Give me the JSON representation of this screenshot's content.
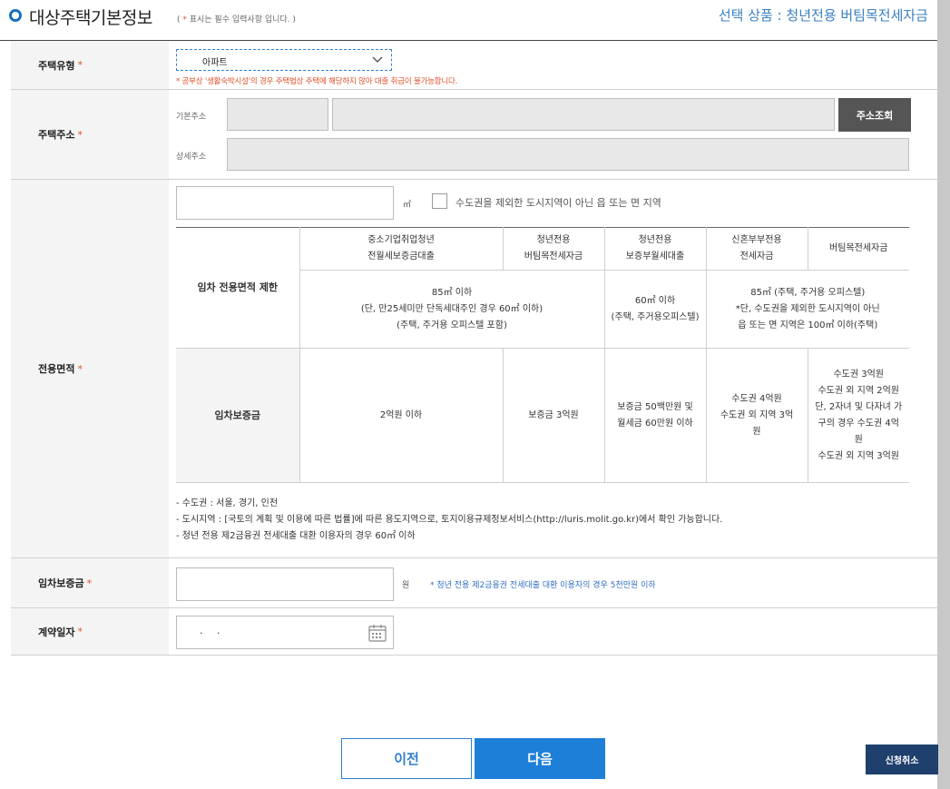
{
  "header": {
    "title": "대상주택기본정보",
    "required_note_star": "*",
    "required_note": " 표시는 필수 입력사항 입니다.",
    "product_label": "선택 상품 : 청년전용 버팀목전세자금"
  },
  "housing_type": {
    "label": "주택유형",
    "required_mark": "*",
    "selected": "아파트",
    "warning": "* 공부상 '생활숙박시설'의 경우 주택법상 주택에 해당하지 않아 대출 취급이 불가능합니다."
  },
  "address": {
    "label": "주택주소",
    "required_mark": "*",
    "basic_label": "기본주소",
    "detail_label": "상세주소",
    "search_button": "주소조회"
  },
  "area": {
    "label": "전용면적",
    "required_mark": "*",
    "unit": "㎡",
    "checkbox_label": "수도권을 제외한 도시지역이 아닌 읍 또는 면 지역",
    "table": {
      "headers": [
        "중소기업취업청년\n전월세보증금대출",
        "청년전용\n버팀목전세자금",
        "청년전용\n보증부월세대출",
        "신혼부부전용\n전세자금",
        "버팀목전세자금"
      ],
      "area_limit_label": "임차 전용면적 제한",
      "area_limits": [
        "85㎡ 이하\n(단, 만25세미만 단독세대주인 경우 60㎡ 이하)\n(주택, 주거용 오피스텔 포함)",
        "60㎡ 이하\n(주택, 주거용오피스텔)",
        "85㎡ (주택, 주거용 오피스텔)\n*단, 수도권을 제외한 도시지역이 아닌\n읍 또는 면 지역은 100㎡ 이하(주택)"
      ],
      "deposit_label": "임차보증금",
      "deposits": [
        "2억원 이하",
        "보증금 3억원",
        "보증금 50백만원 및\n월세금 60만원 이하",
        "수도권 4억원\n수도권 외 지역 3억\n원",
        "수도권 3억원\n수도권 외 지역 2억원\n단, 2자녀 및 다자녀 가\n구의 경우 수도권 4억\n원\n수도권 외 지역 3억원"
      ]
    },
    "notes": [
      "- 수도권 : 서울, 경기, 인천",
      "- 도시지역 : [국토의 계획 및 이용에 따른 법률]에 따른 용도지역으로, 토지이용규제정보서비스(http://luris.molit.go.kr)에서 확인 가능합니다.",
      "- 청년 전용 제2금융권 전세대출 대환 이용자의 경우 60㎡ 이하"
    ]
  },
  "deposit": {
    "label": "임차보증금",
    "required_mark": "*",
    "unit": "원",
    "note": "* 청년 전용 제2금융권 전세대출 대환 이용자의 경우 5천만원 이하"
  },
  "contract_date": {
    "label": "계약일자",
    "required_mark": "*",
    "value": ". ."
  },
  "buttons": {
    "prev": "이전",
    "next": "다음",
    "cancel": "신청취소"
  },
  "colors": {
    "accent": "#1e7fd8",
    "required": "#e0502a",
    "cancel_bg": "#1f3f6c"
  }
}
